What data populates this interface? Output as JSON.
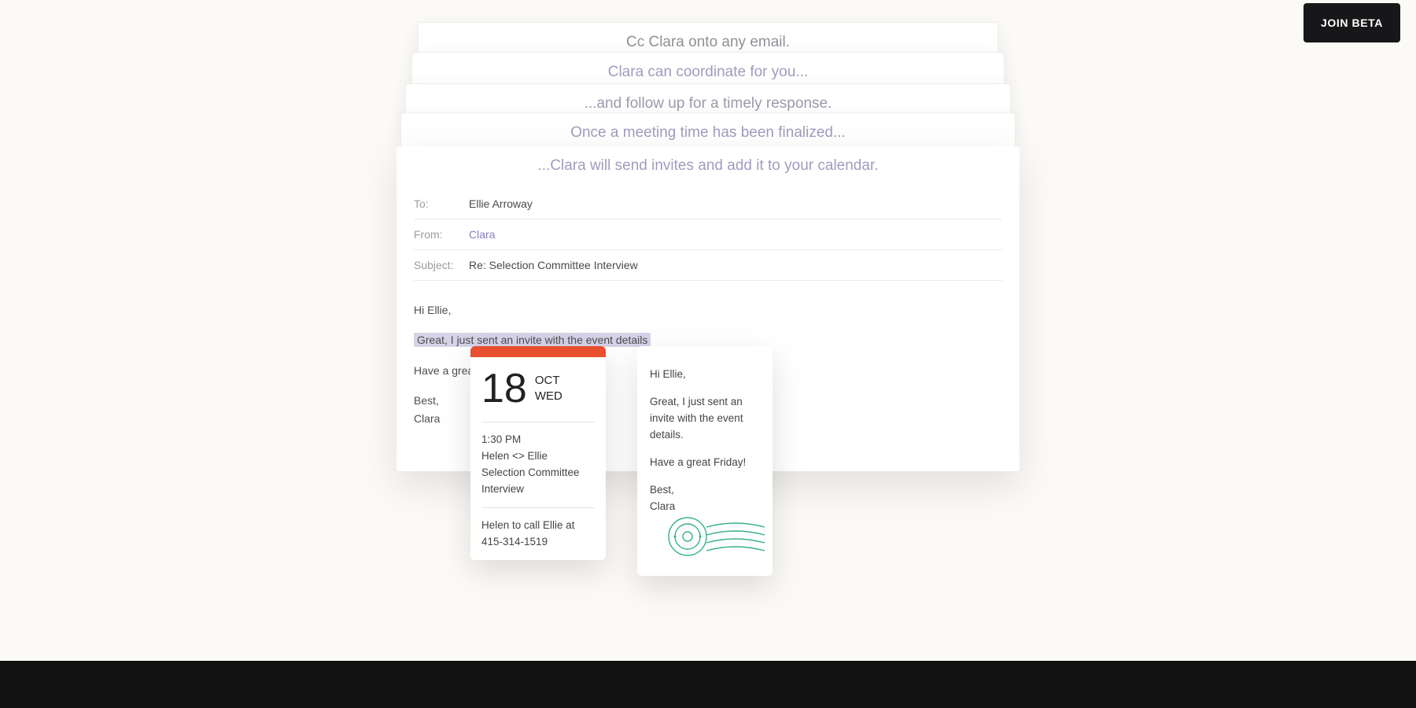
{
  "cta": {
    "label": "JOIN BETA"
  },
  "stack": {
    "line1": "Cc Clara onto any email.",
    "line2": "Clara can coordinate for you...",
    "line3": "...and follow up for a timely response.",
    "line4": "Once a meeting time has been finalized..."
  },
  "email": {
    "headline": "...Clara will send invites and add it to your calendar.",
    "to_label": "To:",
    "to_value": "Ellie Arroway",
    "from_label": "From:",
    "from_value": "Clara",
    "subject_label": "Subject:",
    "subject_value": "Re: Selection Committee Interview",
    "greeting": "Hi Ellie,",
    "highlight": "Great, I just sent an invite with the event details",
    "line3": "Have a great Friday!",
    "signoff": "Best,",
    "signature": "Clara"
  },
  "calendar": {
    "day": "18",
    "month": "OCT",
    "weekday": "WED",
    "time": "1:30 PM",
    "title": "Helen <> Ellie",
    "subtitle": "Selection Committee Interview",
    "note": "Helen to call Ellie at 415-314-1519"
  },
  "note": {
    "greeting": "Hi Ellie,",
    "body": "Great, I just sent an invite with the event details.",
    "line3": "Have a great Friday!",
    "signoff": "Best,",
    "signature": "Clara"
  }
}
